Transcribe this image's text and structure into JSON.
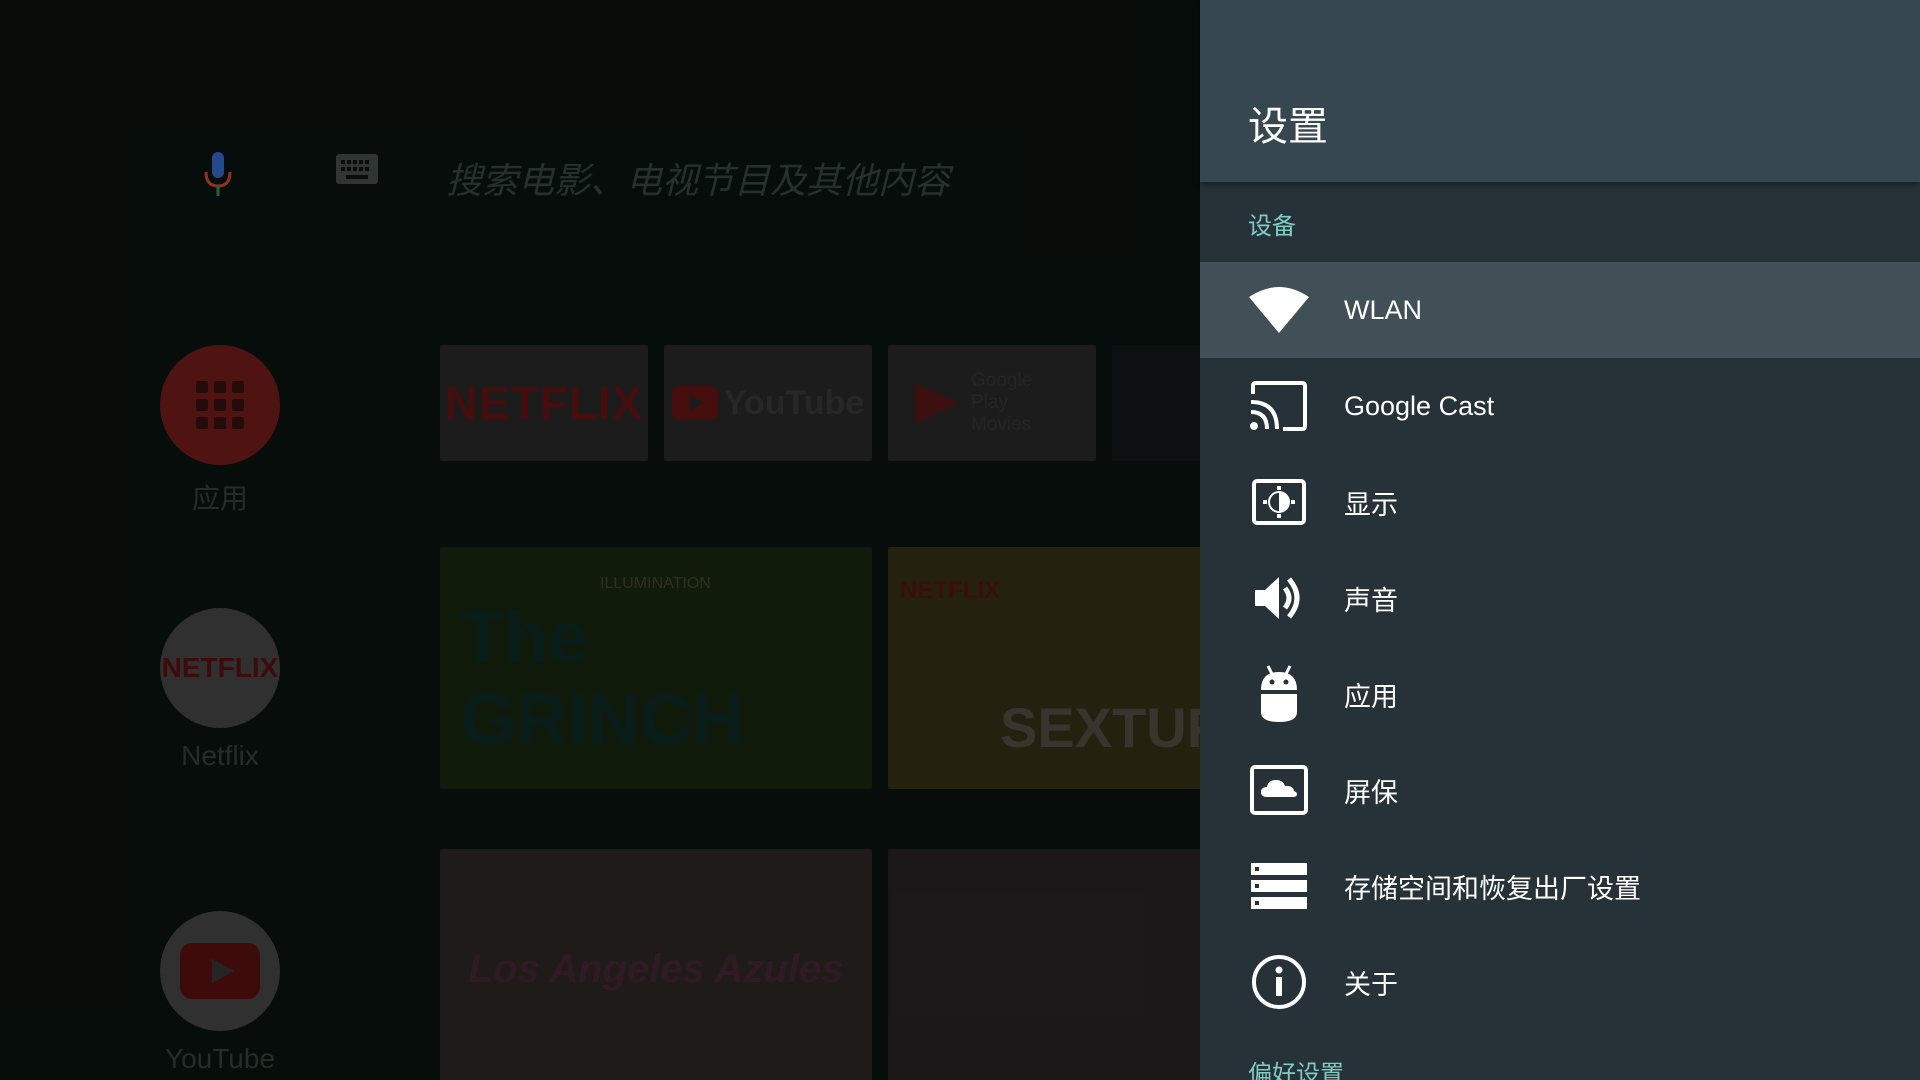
{
  "search": {
    "placeholder": "搜索电影、电视节目及其他内容"
  },
  "home": {
    "side_apps": [
      {
        "label": "应用",
        "icon": "apps-grid-icon"
      },
      {
        "label": "Netflix",
        "icon": "netflix-logo"
      },
      {
        "label": "YouTube",
        "icon": "youtube-logo"
      }
    ],
    "favorites": [
      {
        "label": "NETFLIX"
      },
      {
        "label": "YouTube"
      },
      {
        "label": "Google Play Movies"
      }
    ],
    "netflix_row": [
      {
        "brand": "ILLUMINATION",
        "title": "The GRINCH"
      },
      {
        "brand": "NETFLIX",
        "title": "SEXTUPLETS"
      }
    ],
    "youtube_row": [
      {
        "title": "Los Angeles Azules"
      },
      {
        "title": ""
      }
    ]
  },
  "settings": {
    "title": "设置",
    "section_device": "设备",
    "items": [
      {
        "label": "WLAN",
        "icon": "wifi-icon",
        "selected": true
      },
      {
        "label": "Google Cast",
        "icon": "cast-icon"
      },
      {
        "label": "显示",
        "icon": "display-icon"
      },
      {
        "label": "声音",
        "icon": "volume-icon"
      },
      {
        "label": "应用",
        "icon": "android-icon"
      },
      {
        "label": "屏保",
        "icon": "screensaver-icon"
      },
      {
        "label": "存储空间和恢复出厂设置",
        "icon": "storage-icon"
      },
      {
        "label": "关于",
        "icon": "info-icon"
      }
    ],
    "section_preferences": "偏好设置"
  },
  "colors": {
    "panel_bg": "#263238",
    "panel_header_bg": "#37474f",
    "selected_bg": "#414f56",
    "section_accent": "#80cbc4"
  }
}
